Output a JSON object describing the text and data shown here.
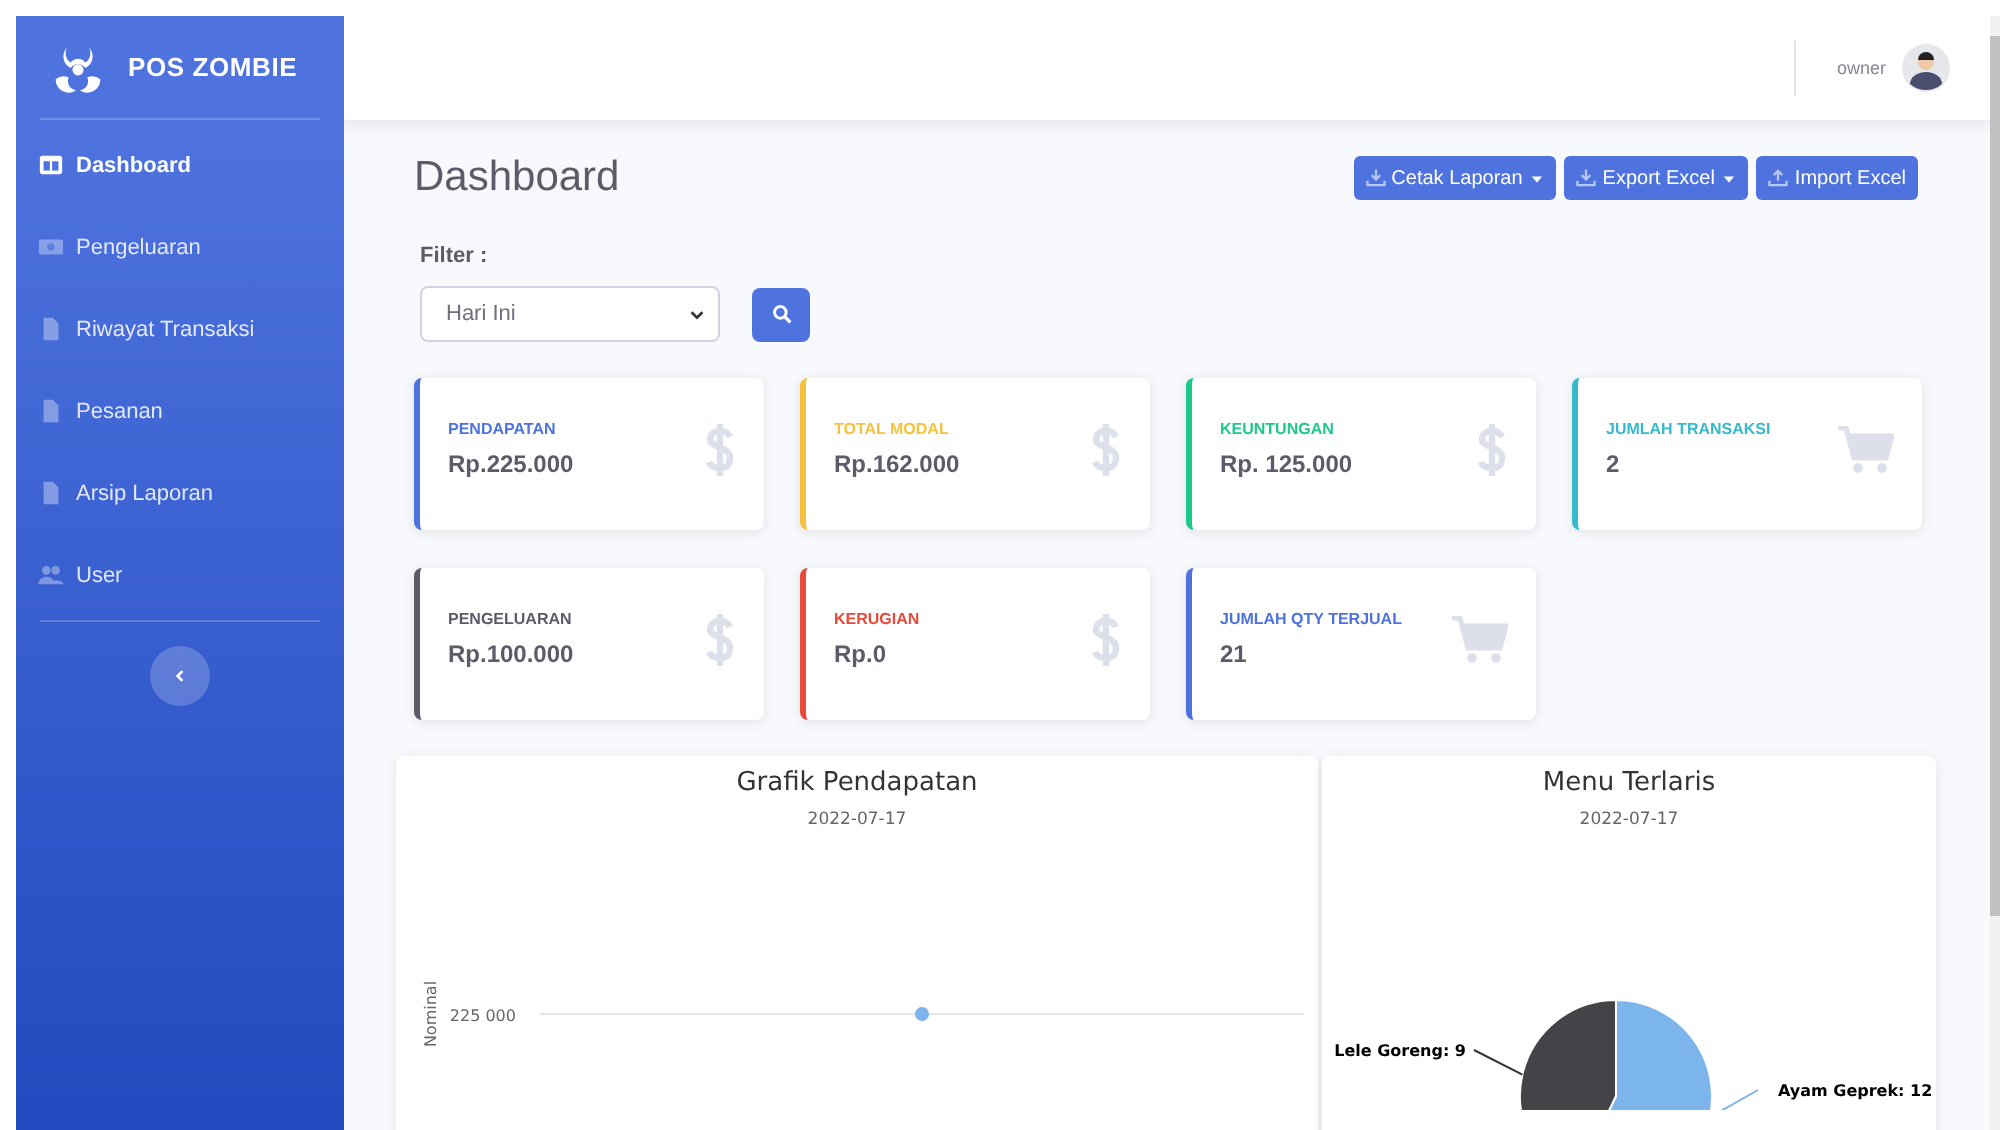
{
  "sidebar": {
    "brand": "POS ZOMBIE",
    "items": [
      {
        "label": "Dashboard",
        "selected": true
      },
      {
        "label": "Pengeluaran",
        "selected": false
      },
      {
        "label": "Riwayat Transaksi",
        "selected": false
      },
      {
        "label": "Pesanan",
        "selected": false
      },
      {
        "label": "Arsip Laporan",
        "selected": false
      },
      {
        "label": "User",
        "selected": false
      }
    ]
  },
  "topbar": {
    "user": "owner"
  },
  "page": {
    "title": "Dashboard",
    "buttons": [
      {
        "label": "Cetak Laporan",
        "dropdown": true
      },
      {
        "label": "Export Excel",
        "dropdown": true
      },
      {
        "label": "Import Excel",
        "dropdown": false
      }
    ]
  },
  "filter": {
    "label": "Filter :",
    "value": "Hari Ini"
  },
  "stats": [
    {
      "label": "PENDAPATAN",
      "value": "Rp.225.000",
      "color": "#4e73df",
      "kind": "amount"
    },
    {
      "label": "TOTAL MODAL",
      "value": "Rp.162.000",
      "color": "#f6c23e",
      "kind": "amount"
    },
    {
      "label": "KEUNTUNGAN",
      "value": "Rp. 125.000",
      "color": "#1cc88a",
      "kind": "amount"
    },
    {
      "label": "JUMLAH TRANSAKSI",
      "value": "2",
      "color": "#36b9cc",
      "kind": "count"
    },
    {
      "label": "PENGELUARAN",
      "value": "Rp.100.000",
      "color": "#5a5c69",
      "kind": "amount"
    },
    {
      "label": "KERUGIAN",
      "value": "Rp.0",
      "color": "#e74a3b",
      "kind": "amount"
    },
    {
      "label": "JUMLAH QTY TERJUAL",
      "value": "21",
      "color": "#4e73df",
      "kind": "count"
    }
  ],
  "revenue_chart": {
    "title": "Grafik Pendapatan",
    "subtitle": "2022-07-17",
    "y_axis_title": "Nominal",
    "tick_label": "225 000"
  },
  "menu_chart": {
    "subtitle": "2022-07-17",
    "chart_data": {
      "type": "pie",
      "title": "Menu Terlaris",
      "categories": [
        "Ayam Geprek: 12",
        "Lele Goreng: 9"
      ],
      "series": [
        {
          "values": [
            12,
            9
          ]
        }
      ]
    }
  }
}
